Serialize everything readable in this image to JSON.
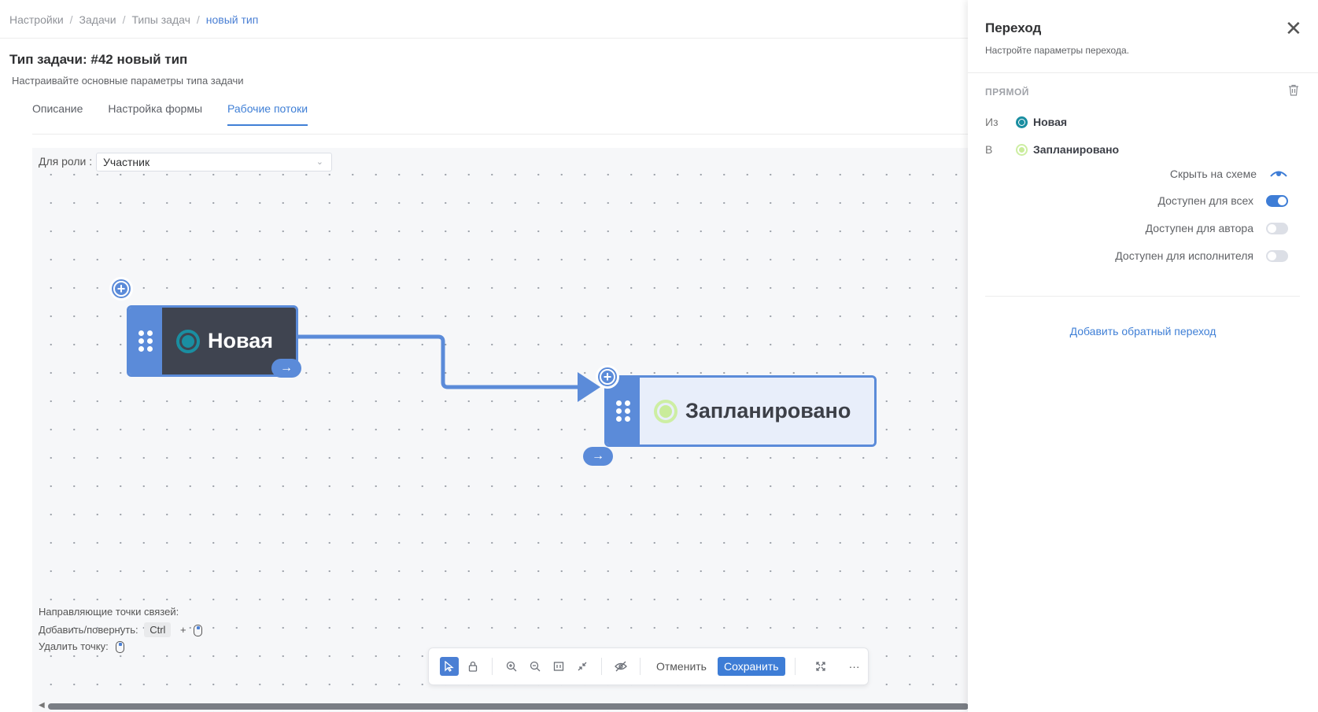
{
  "breadcrumb": {
    "items": [
      "Настройки",
      "Задачи",
      "Типы задач"
    ],
    "current": "новый тип",
    "separator": "/"
  },
  "page": {
    "title": "Тип задачи: #42 новый тип",
    "subtitle": "Настраивайте основные параметры типа задачи"
  },
  "tabs": [
    {
      "label": "Описание",
      "active": false
    },
    {
      "label": "Настройка формы",
      "active": false
    },
    {
      "label": "Рабочие потоки",
      "active": true
    }
  ],
  "role_filter": {
    "label": "Для роли :",
    "value": "Участник"
  },
  "workflow": {
    "nodes": [
      {
        "label": "Новая",
        "status_color": "#1a8ea1"
      },
      {
        "label": "Запланировано",
        "status_color": "#c9ec9a"
      }
    ],
    "edge": {
      "from": "Новая",
      "to": "Запланировано"
    },
    "accent_color": "#5b8bd9"
  },
  "hints": {
    "title": "Направляющие точки связей:",
    "add_rotate_label": "Добавить/повернуть:",
    "add_key": "Ctrl",
    "plus": "+",
    "delete_label": "Удалить точку:"
  },
  "toolbar": {
    "cancel_label": "Отменить",
    "save_label": "Сохранить",
    "more_label": "···",
    "icons": [
      "pointer-icon",
      "lock-icon",
      "zoom-in-icon",
      "zoom-out-icon",
      "fit-icon",
      "collapse-icon",
      "hide-icon",
      "fullscreen-icon"
    ]
  },
  "panel": {
    "title": "Переход",
    "subtitle": "Настройте параметры перехода.",
    "section_label": "ПРЯМОЙ",
    "from_label": "Из",
    "from_value": "Новая",
    "to_label": "В",
    "to_value": "Запланировано",
    "options": [
      {
        "label": "Скрыть на схеме",
        "control": "eye"
      },
      {
        "label": "Доступен для всех",
        "control": "toggle",
        "on": true
      },
      {
        "label": "Доступен для автора",
        "control": "toggle",
        "on": false
      },
      {
        "label": "Доступен для исполнителя",
        "control": "toggle",
        "on": false
      }
    ],
    "reverse_link": "Добавить обратный переход"
  }
}
